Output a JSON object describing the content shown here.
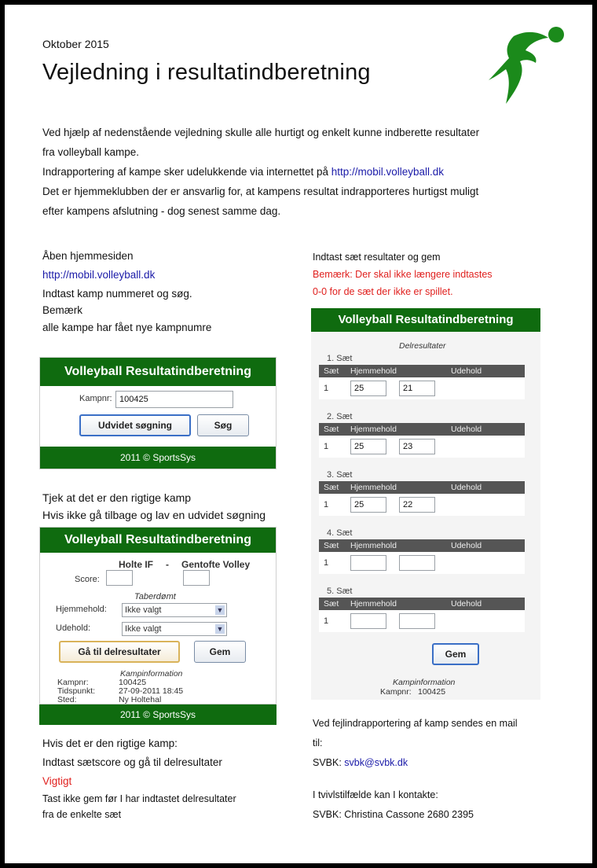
{
  "header": {
    "date": "Oktober 2015",
    "title": "Vejledning i resultatindberetning"
  },
  "logo": {
    "icon": "volleyball-player-logo-icon",
    "green": "#1b8a1b"
  },
  "intro": {
    "line1": "Ved hjælp af nedenstående vejledning skulle alle hurtigt og enkelt kunne indberette resultater",
    "line2": "fra volleyball kampe.",
    "line3_text": "Indrapportering af kampe sker udelukkende via internettet på ",
    "line3_link": "http://mobil.volleyball.dk",
    "line4": "Det er hjemmeklubben der er ansvarlig for, at kampens resultat indrapporteres hurtigst muligt",
    "line5": "efter kampens afslutning - dog senest samme dag."
  },
  "left": {
    "step1": {
      "line1": "Åben hjemmesiden",
      "link": "http://mobil.volleyball.dk",
      "line2": "Indtast kamp nummeret og søg.",
      "line3": "Bemærk",
      "line4": "alle kampe har fået nye kampnumre"
    },
    "widget1": {
      "title": "Volleyball Resultatindberetning",
      "kampnr_label": "Kampnr:",
      "kampnr_value": "100425",
      "btn_extended": "Udvidet søgning",
      "btn_search": "Søg",
      "footer": "2011 © SportsSys"
    },
    "step2": {
      "line1": "Tjek at det er den rigtige kamp",
      "line2": "Hvis ikke gå tilbage og lav en udvidet søgning"
    },
    "widget2": {
      "title": "Volleyball Resultatindberetning",
      "home_team": "Holte IF",
      "dash": "-",
      "away_team": "Gentofte Volley",
      "score_label": "Score:",
      "taberdomt_label": "Taberdømt",
      "home_label": "Hjemmehold:",
      "away_label": "Udehold:",
      "home_select": "Ikke valgt",
      "away_select": "Ikke valgt",
      "btn_delresultater": "Gå til delresultater",
      "btn_gem": "Gem",
      "info_title": "Kampinformation",
      "info_kampnr_label": "Kampnr:",
      "info_kampnr_value": "100425",
      "info_tid_label": "Tidspunkt:",
      "info_tid_value": "27-09-2011 18:45",
      "info_sted_label": "Sted:",
      "info_sted_value": "Ny Holtehal",
      "footer": "2011 © SportsSys"
    },
    "step3": {
      "line1": "Hvis det er den rigtige kamp:",
      "line2": "Indtast sætscore og gå til delresultater",
      "important": "Vigtigt",
      "line3": "Tast ikke gem før I har indtastet delresultater",
      "line4": "fra de enkelte sæt"
    }
  },
  "right": {
    "intro": {
      "line1": "Indtast sæt resultater og gem",
      "note1": "Bemærk: Der skal ikke længere indtastes",
      "note2": "0-0 for de sæt der ikke er spillet."
    },
    "widget3": {
      "title": "Volleyball Resultatindberetning",
      "delresultater": "Delresultater",
      "col_set": "Sæt",
      "col_home": "Hjemmehold",
      "col_away": "Udehold",
      "sets": [
        {
          "title": "1. Sæt",
          "num": "1",
          "home": "25",
          "away": "21"
        },
        {
          "title": "2. Sæt",
          "num": "1",
          "home": "25",
          "away": "23"
        },
        {
          "title": "3. Sæt",
          "num": "1",
          "home": "25",
          "away": "22"
        },
        {
          "title": "4. Sæt",
          "num": "1",
          "home": "",
          "away": ""
        },
        {
          "title": "5. Sæt",
          "num": "1",
          "home": "",
          "away": ""
        }
      ],
      "btn_gem": "Gem",
      "info_title": "Kampinformation",
      "info_kampnr_label": "Kampnr:",
      "info_kampnr_value": "100425"
    },
    "contact": {
      "line1": "Ved fejlindrapportering af kamp sendes en mail",
      "line2": "til:",
      "svbk_label": "SVBK: ",
      "svbk_email": "svbk@svbk.dk",
      "line3": "I tvivlstilfælde kan I kontakte:",
      "line4": "SVBK: Christina Cassone 2680 2395"
    }
  }
}
